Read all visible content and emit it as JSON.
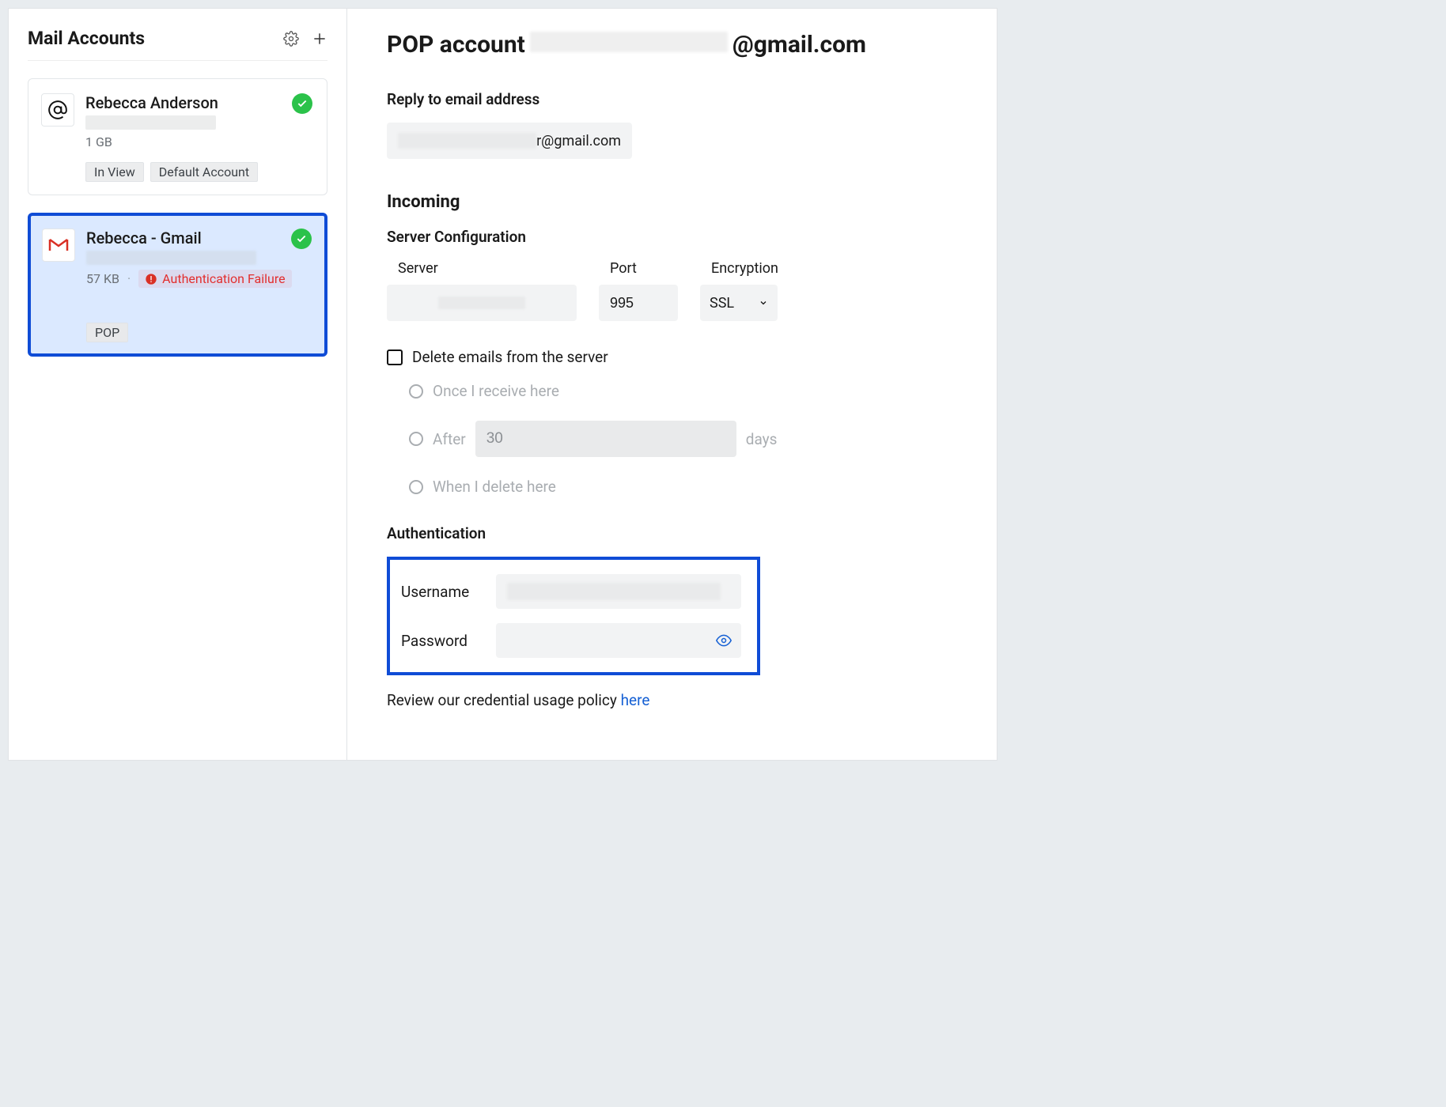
{
  "sidebar": {
    "title": "Mail Accounts",
    "accounts": [
      {
        "name": "Rebecca Anderson",
        "size": "1 GB",
        "tags": [
          "In View",
          "Default Account"
        ],
        "icon": "at",
        "status": "ok",
        "selected": false
      },
      {
        "name": "Rebecca - Gmail",
        "size": "57 KB",
        "tags": [
          "POP"
        ],
        "icon": "gmail",
        "status": "ok",
        "error": "Authentication Failure",
        "selected": true
      }
    ]
  },
  "main": {
    "title_prefix": "POP account",
    "title_suffix": "@gmail.com",
    "reply_label": "Reply to email address",
    "reply_suffix": "r@gmail.com",
    "incoming_label": "Incoming",
    "server_config_label": "Server Configuration",
    "server_col": "Server",
    "port_col": "Port",
    "encryption_col": "Encryption",
    "port_value": "995",
    "encryption_value": "SSL",
    "delete_label": "Delete emails from the server",
    "delete_checked": false,
    "options": {
      "once": "Once I receive here",
      "after": "After",
      "after_value": "30",
      "after_unit": "days",
      "when_delete": "When I delete here"
    },
    "auth_label": "Authentication",
    "username_label": "Username",
    "password_label": "Password",
    "policy_text": "Review our credential usage policy ",
    "policy_link": "here"
  }
}
